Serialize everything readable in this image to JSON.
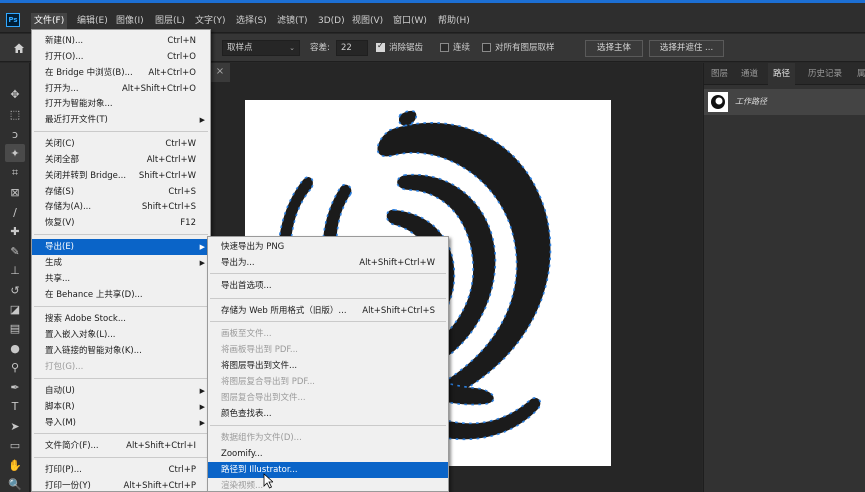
{
  "menubar": {
    "app_icon": "Ps",
    "items": [
      "文件(F)",
      "编辑(E)",
      "图像(I)",
      "图层(L)",
      "文字(Y)",
      "选择(S)",
      "滤镜(T)",
      "3D(D)",
      "视图(V)",
      "窗口(W)",
      "帮助(H)"
    ]
  },
  "options": {
    "sample_mode": "取样点",
    "tolerance_label": "容差:",
    "tolerance_value": "22",
    "antialias_label": "消除锯齿",
    "contiguous_label": "连续",
    "all_layers_label": "对所有图层取样",
    "select_subject": "选择主体",
    "select_mask": "选择并遮住 ..."
  },
  "panel": {
    "tabs": [
      "图层",
      "通道",
      "路径",
      "历史记录",
      "属"
    ],
    "active_tab": "路径",
    "path_name": "工作路径"
  },
  "file_menu": {
    "items": [
      {
        "label": "新建(N)...",
        "shortcut": "Ctrl+N"
      },
      {
        "label": "打开(O)...",
        "shortcut": "Ctrl+O"
      },
      {
        "label": "在 Bridge 中浏览(B)...",
        "shortcut": "Alt+Ctrl+O"
      },
      {
        "label": "打开为...",
        "shortcut": "Alt+Shift+Ctrl+O"
      },
      {
        "label": "打开为智能对象...",
        "shortcut": ""
      },
      {
        "label": "最近打开文件(T)",
        "shortcut": "",
        "submenu": true
      },
      {
        "label": "关闭(C)",
        "shortcut": "Ctrl+W"
      },
      {
        "label": "关闭全部",
        "shortcut": "Alt+Ctrl+W"
      },
      {
        "label": "关闭并转到 Bridge...",
        "shortcut": "Shift+Ctrl+W"
      },
      {
        "label": "存储(S)",
        "shortcut": "Ctrl+S"
      },
      {
        "label": "存储为(A)...",
        "shortcut": "Shift+Ctrl+S"
      },
      {
        "label": "恢复(V)",
        "shortcut": "F12"
      },
      {
        "label": "导出(E)",
        "shortcut": "",
        "submenu": true,
        "highlight": true
      },
      {
        "label": "生成",
        "shortcut": "",
        "submenu": true
      },
      {
        "label": "共享...",
        "shortcut": ""
      },
      {
        "label": "在 Behance 上共享(D)...",
        "shortcut": ""
      },
      {
        "label": "搜索 Adobe Stock...",
        "shortcut": ""
      },
      {
        "label": "置入嵌入对象(L)...",
        "shortcut": ""
      },
      {
        "label": "置入链接的智能对象(K)...",
        "shortcut": ""
      },
      {
        "label": "打包(G)...",
        "shortcut": "",
        "disabled": true
      },
      {
        "label": "自动(U)",
        "shortcut": "",
        "submenu": true
      },
      {
        "label": "脚本(R)",
        "shortcut": "",
        "submenu": true
      },
      {
        "label": "导入(M)",
        "shortcut": "",
        "submenu": true
      },
      {
        "label": "文件简介(F)...",
        "shortcut": "Alt+Shift+Ctrl+I"
      },
      {
        "label": "打印(P)...",
        "shortcut": "Ctrl+P"
      },
      {
        "label": "打印一份(Y)",
        "shortcut": "Alt+Shift+Ctrl+P"
      }
    ]
  },
  "export_menu": {
    "items": [
      {
        "label": "快速导出为 PNG",
        "shortcut": ""
      },
      {
        "label": "导出为...",
        "shortcut": "Alt+Shift+Ctrl+W"
      },
      {
        "label": "导出首选项...",
        "shortcut": ""
      },
      {
        "label": "存储为 Web 所用格式（旧版）...",
        "shortcut": "Alt+Shift+Ctrl+S"
      },
      {
        "label": "画板至文件...",
        "shortcut": "",
        "disabled": true
      },
      {
        "label": "将画板导出到 PDF...",
        "shortcut": "",
        "disabled": true
      },
      {
        "label": "将图层导出到文件...",
        "shortcut": ""
      },
      {
        "label": "将图层复合导出到 PDF...",
        "shortcut": "",
        "disabled": true
      },
      {
        "label": "图层复合导出到文件...",
        "shortcut": "",
        "disabled": true
      },
      {
        "label": "颜色查找表...",
        "shortcut": ""
      },
      {
        "label": "数据组作为文件(D)...",
        "shortcut": "",
        "disabled": true
      },
      {
        "label": "Zoomify...",
        "shortcut": ""
      },
      {
        "label": "路径到 Illustrator...",
        "shortcut": "",
        "highlight": true
      },
      {
        "label": "渲染视频...",
        "shortcut": "",
        "disabled": true
      }
    ]
  }
}
